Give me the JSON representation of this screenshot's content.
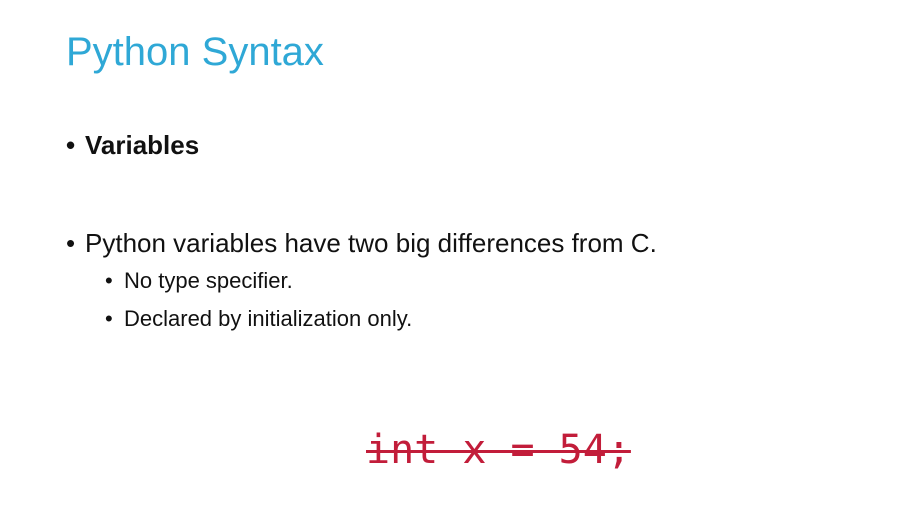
{
  "slide": {
    "title": "Python Syntax",
    "bullets": [
      {
        "marker": "•",
        "text": "Variables"
      },
      {
        "marker": "•",
        "text": "Python variables have two big differences from C."
      }
    ],
    "sub_bullets": [
      {
        "marker": "•",
        "text": "No type specifier."
      },
      {
        "marker": "•",
        "text": "Declared by initialization only."
      }
    ],
    "code_example": "int x = 54;",
    "colors": {
      "title": "#2fa8d6",
      "code": "#c21d3a",
      "text": "#111111"
    }
  }
}
